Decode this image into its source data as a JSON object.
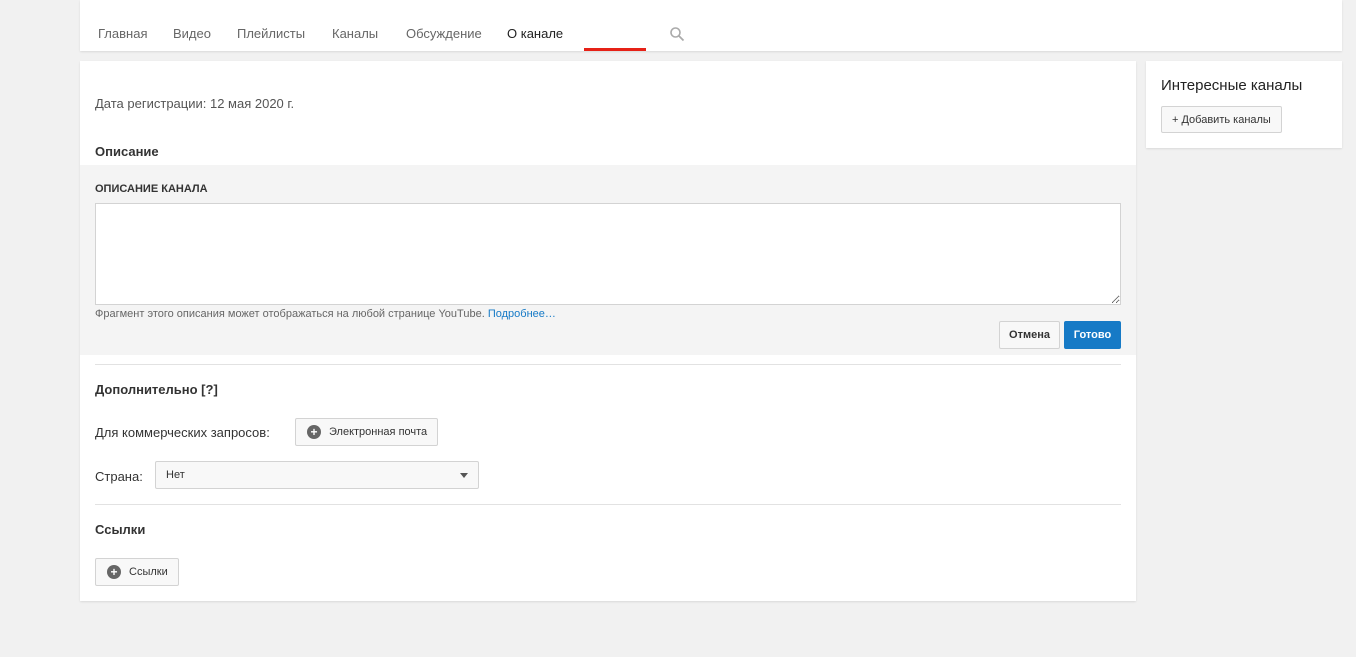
{
  "tabs": [
    {
      "label": "Главная",
      "active": false
    },
    {
      "label": "Видео",
      "active": false
    },
    {
      "label": "Плейлисты",
      "active": false
    },
    {
      "label": "Каналы",
      "active": false
    },
    {
      "label": "Обсуждение",
      "active": false
    },
    {
      "label": "О канале",
      "active": true
    }
  ],
  "tab_search_icon": "search-icon",
  "about": {
    "registration": "Дата регистрации: 12 мая 2020 г.",
    "description_heading": "Описание",
    "description_label": "ОПИСАНИЕ КАНАЛА",
    "description_value": "",
    "hint_text": "Фрагмент этого описания может отображаться на любой странице YouTube.",
    "hint_link": "Подробнее…",
    "cancel_label": "Отмена",
    "done_label": "Готово",
    "additional_heading": "Дополнительно [?]",
    "business_label": "Для коммерческих запросов:",
    "email_button": "Электронная почта",
    "country_label": "Страна:",
    "country_value": "Нет",
    "links_heading": "Ссылки",
    "links_button": "Ссылки"
  },
  "sidebar": {
    "title": "Интересные каналы",
    "add_button": "+ Добавить каналы"
  },
  "colors": {
    "accent": "#167ac6",
    "tab_underline": "#e62117",
    "background": "#f1f1f1"
  }
}
